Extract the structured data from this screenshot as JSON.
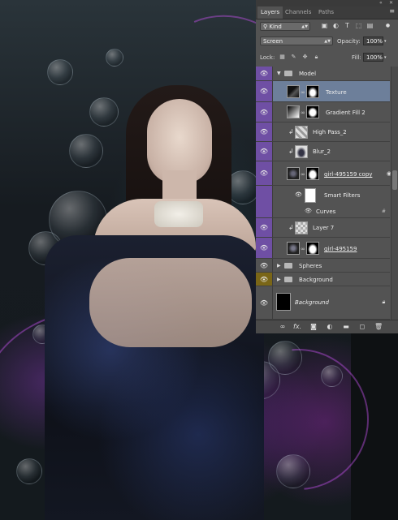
{
  "panel": {
    "tabs": [
      {
        "label": "Layers",
        "active": true
      },
      {
        "label": "Channels",
        "active": false
      },
      {
        "label": "Paths",
        "active": false
      }
    ],
    "filter": {
      "label": "Kind",
      "icon": "search-icon"
    },
    "filter_icons": [
      "image-filter-icon",
      "adjustment-filter-icon",
      "type-filter-icon",
      "shape-filter-icon",
      "smart-object-filter-icon"
    ],
    "blend_mode": "Screen",
    "opacity_label": "Opacity:",
    "opacity_value": "100%",
    "lock_label": "Lock:",
    "fill_label": "Fill:",
    "fill_value": "100%",
    "lock_icons": [
      "lock-transparent-icon",
      "lock-image-icon",
      "lock-position-icon",
      "lock-all-icon"
    ],
    "layers": [
      {
        "name": "Model",
        "type": "group",
        "expanded": true,
        "eye_color": "purple"
      },
      {
        "name": "Texture",
        "type": "layer",
        "selected": true,
        "eye_color": "purple"
      },
      {
        "name": "Gradient Fill 2",
        "type": "fill",
        "eye_color": "purple"
      },
      {
        "name": "High Pass_2",
        "type": "clipped",
        "eye_color": "purple"
      },
      {
        "name": "Blur_2",
        "type": "clipped",
        "eye_color": "purple"
      },
      {
        "name": "girl-495159 copy",
        "type": "smart",
        "eye_color": "purple"
      },
      {
        "name": "Smart Filters",
        "type": "smart-filters",
        "eye_color": "purple"
      },
      {
        "name": "Curves",
        "type": "filter",
        "eye_color": "purple"
      },
      {
        "name": "Layer 7",
        "type": "clipped",
        "eye_color": "purple"
      },
      {
        "name": "girl-495159",
        "type": "layer",
        "eye_color": "purple"
      },
      {
        "name": "Spheres",
        "type": "group",
        "expanded": false,
        "eye_color": "none"
      },
      {
        "name": "Background",
        "type": "group",
        "expanded": false,
        "eye_color": "gold"
      },
      {
        "name": "Background",
        "type": "background",
        "eye_color": "none"
      }
    ],
    "bottom_icons": [
      "link-icon",
      "fx-icon",
      "mask-icon",
      "adjustment-icon",
      "folder-icon",
      "new-layer-icon",
      "trash-icon"
    ],
    "fx_label": "fx."
  },
  "colors": {
    "panel_bg": "#535353",
    "selected_row": "#6d7f9a",
    "eye_purple": "#6f4fa4",
    "eye_gold": "#7a6617"
  }
}
